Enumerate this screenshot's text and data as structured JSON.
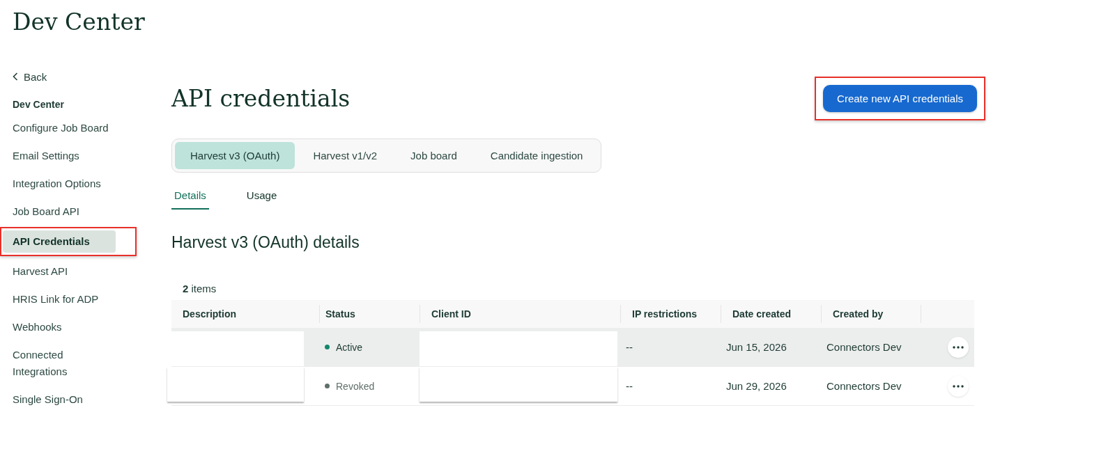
{
  "app_title": "Dev Center",
  "sidebar": {
    "back": "Back",
    "section": "Dev Center",
    "items": [
      {
        "label": "Configure Job Board",
        "selected": false,
        "highlighted": false
      },
      {
        "label": "Email Settings",
        "selected": false,
        "highlighted": false
      },
      {
        "label": "Integration Options",
        "selected": false,
        "highlighted": false
      },
      {
        "label": "Job Board API",
        "selected": false,
        "highlighted": false
      },
      {
        "label": "API Credentials",
        "selected": true,
        "highlighted": true
      },
      {
        "label": "Harvest API",
        "selected": false,
        "highlighted": false
      },
      {
        "label": "HRIS Link for ADP",
        "selected": false,
        "highlighted": false
      },
      {
        "label": "Webhooks",
        "selected": false,
        "highlighted": false
      },
      {
        "label": "Connected Integrations",
        "selected": false,
        "highlighted": false
      },
      {
        "label": "Single Sign-On",
        "selected": false,
        "highlighted": false
      }
    ]
  },
  "page_title": "API credentials",
  "create_button": {
    "label": "Create new API credentials",
    "highlighted": true
  },
  "tabs": [
    {
      "label": "Harvest v3 (OAuth)",
      "selected": true
    },
    {
      "label": "Harvest v1/v2",
      "selected": false
    },
    {
      "label": "Job board",
      "selected": false
    },
    {
      "label": "Candidate ingestion",
      "selected": false
    }
  ],
  "subtabs": [
    {
      "label": "Details",
      "selected": true
    },
    {
      "label": "Usage",
      "selected": false
    }
  ],
  "section_title": "Harvest v3 (OAuth) details",
  "item_count": {
    "number": "2",
    "label": "items"
  },
  "table": {
    "redacted": true,
    "columns": [
      "Description",
      "Status",
      "Client ID",
      "IP restrictions",
      "Date created",
      "Created by"
    ],
    "rows": [
      {
        "status": "Active",
        "color": "#14876b",
        "ip_restrictions": "--",
        "date_created": "Jun 15, 2026",
        "created_by": "Connectors Dev",
        "selected": true
      },
      {
        "status": "Revoked",
        "color": "#5f6f69",
        "ip_restrictions": "--",
        "date_created": "Jun 29, 2026",
        "created_by": "Connectors Dev",
        "selected": false
      }
    ]
  }
}
